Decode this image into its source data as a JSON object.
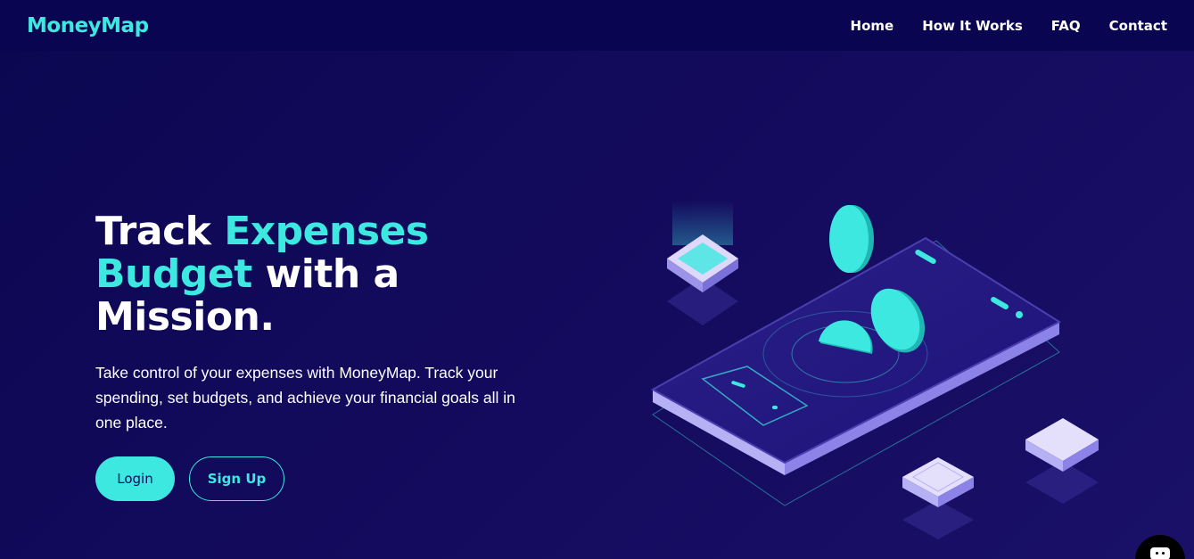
{
  "brand": {
    "name": "MoneyMap"
  },
  "nav": {
    "items": [
      {
        "label": "Home"
      },
      {
        "label": "How It Works"
      },
      {
        "label": "FAQ"
      },
      {
        "label": "Contact"
      }
    ]
  },
  "hero": {
    "title": {
      "part1": "Track ",
      "accent1": "Expenses",
      "accent2": "Budget",
      "part2": " with a",
      "part3": "Mission."
    },
    "description": "Take control of your expenses with MoneyMap. Track your spending, set budgets, and achieve your financial goals all in one place.",
    "login_label": "Login",
    "signup_label": "Sign Up"
  },
  "colors": {
    "background": "#130a5c",
    "navbar": "#0a0550",
    "accent": "#3de8e0",
    "text": "#ffffff"
  },
  "icons": {
    "chat": "chat-bubble-icon",
    "illustration": "isometric-phone-coins-illustration"
  }
}
